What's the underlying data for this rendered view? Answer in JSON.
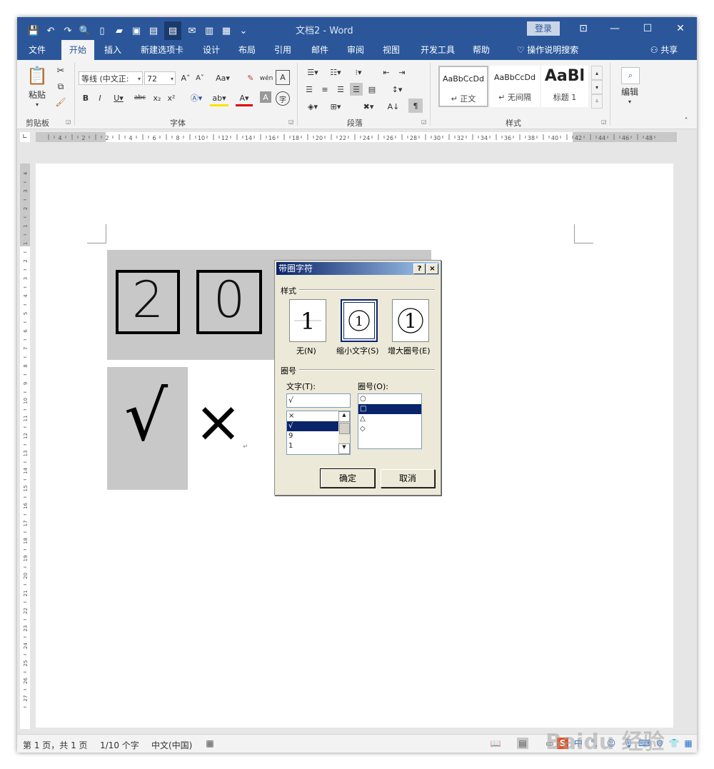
{
  "window": {
    "title": "文档2 - Word",
    "login": "登录"
  },
  "tabs": [
    "文件",
    "开始",
    "插入",
    "新建选项卡",
    "设计",
    "布局",
    "引用",
    "邮件",
    "审阅",
    "视图",
    "开发工具",
    "帮助"
  ],
  "search": {
    "label": "操作说明搜索"
  },
  "share": {
    "label": "共享"
  },
  "ribbon": {
    "clipboard": {
      "paste": "粘贴",
      "group": "剪贴板"
    },
    "font": {
      "name": "等线 (中文正:",
      "size": "72",
      "group": "字体"
    },
    "paragraph": {
      "group": "段落"
    },
    "styles": {
      "group": "样式",
      "items": [
        {
          "preview": "AaBbCcDd",
          "name": "↵ 正文"
        },
        {
          "preview": "AaBbCcDd",
          "name": "↵ 无间隔"
        },
        {
          "preview": "AaBl",
          "name": "标题 1"
        }
      ]
    },
    "editing": {
      "label": "编辑"
    }
  },
  "ruler_ticks": [
    "4",
    "2",
    "2",
    "4",
    "6",
    "8",
    "10",
    "12",
    "14",
    "16",
    "18",
    "20",
    "22",
    "24",
    "26",
    "28",
    "30",
    "32",
    "34",
    "36",
    "38",
    "40",
    "42",
    "44",
    "46",
    "48"
  ],
  "vruler_ticks": [
    "4",
    "3",
    "2",
    "1",
    "1",
    "2",
    "3",
    "4",
    "5",
    "6",
    "7",
    "8",
    "9",
    "10",
    "11",
    "12",
    "13",
    "14",
    "15",
    "16",
    "17",
    "18",
    "19",
    "20",
    "21",
    "22",
    "23",
    "24",
    "25",
    "26",
    "27"
  ],
  "document": {
    "boxed_chars": [
      "2",
      "0"
    ],
    "check": "√",
    "cross": "×",
    "pilcrow": "↵"
  },
  "dialog": {
    "title": "带圈字符",
    "help": "?",
    "close": "×",
    "style_section": "样式",
    "options": [
      {
        "label": "无(N)",
        "glyph": "1"
      },
      {
        "label": "缩小文字(S)",
        "glyph": "①"
      },
      {
        "label": "增大圈号(E)",
        "glyph": "①"
      }
    ],
    "enclosure_section": "圈号",
    "text_label": "文字(T):",
    "text_value": "√",
    "text_list": [
      "×",
      "√",
      "9",
      "1"
    ],
    "enclosure_label": "圈号(O):",
    "enclosure_list": [
      "○",
      "□",
      "△",
      "◇"
    ],
    "ok": "确定",
    "cancel": "取消"
  },
  "status": {
    "page": "第 1 页，共 1 页",
    "words": "1/10 个字",
    "lang": "中文(中国)"
  },
  "watermark": "Baidu 经验"
}
